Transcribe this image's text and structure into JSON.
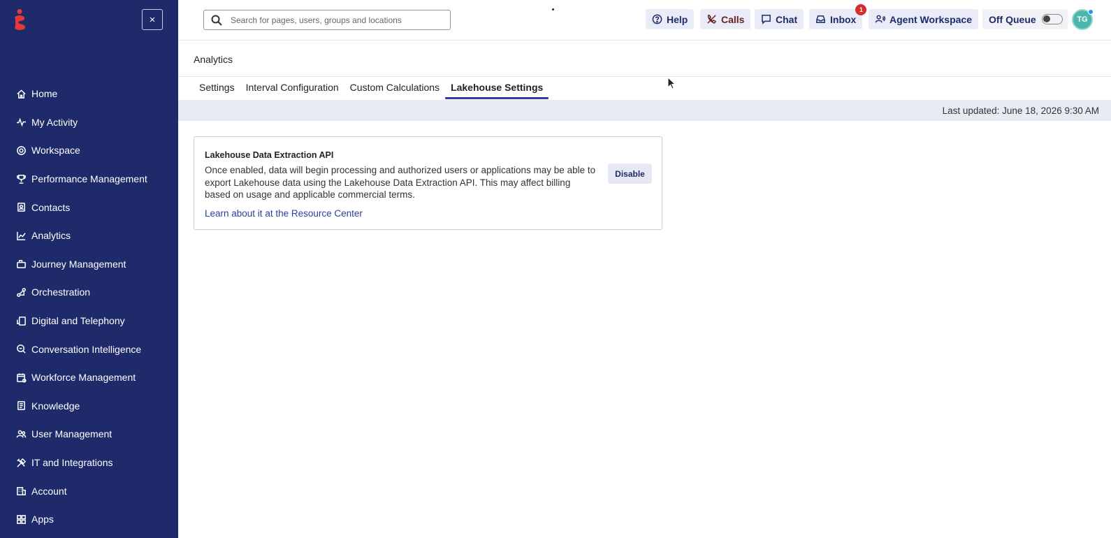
{
  "sidebar": {
    "close_label": "×",
    "items": [
      {
        "label": "Home",
        "icon": "home-icon"
      },
      {
        "label": "My Activity",
        "icon": "activity-icon"
      },
      {
        "label": "Workspace",
        "icon": "workspace-icon"
      },
      {
        "label": "Performance Management",
        "icon": "trophy-icon"
      },
      {
        "label": "Contacts",
        "icon": "contacts-icon"
      },
      {
        "label": "Analytics",
        "icon": "analytics-icon"
      },
      {
        "label": "Journey Management",
        "icon": "journey-icon"
      },
      {
        "label": "Orchestration",
        "icon": "orchestration-icon"
      },
      {
        "label": "Digital and Telephony",
        "icon": "telephony-icon"
      },
      {
        "label": "Conversation Intelligence",
        "icon": "conversation-intelligence-icon"
      },
      {
        "label": "Workforce Management",
        "icon": "calendar-icon"
      },
      {
        "label": "Knowledge",
        "icon": "book-icon"
      },
      {
        "label": "User Management",
        "icon": "users-icon"
      },
      {
        "label": "IT and Integrations",
        "icon": "tools-icon"
      },
      {
        "label": "Account",
        "icon": "building-icon"
      },
      {
        "label": "Apps",
        "icon": "apps-icon"
      }
    ]
  },
  "topbar": {
    "search_placeholder": "Search for pages, users, groups and locations",
    "help": "Help",
    "calls": "Calls",
    "chat": "Chat",
    "inbox": "Inbox",
    "inbox_badge": "1",
    "agent_workspace": "Agent Workspace",
    "queue_status": "Off Queue",
    "avatar_initials": "TG"
  },
  "page": {
    "title": "Analytics",
    "tabs": [
      "Settings",
      "Interval Configuration",
      "Custom Calculations",
      "Lakehouse Settings"
    ],
    "active_tab": "Lakehouse Settings",
    "last_updated": "Last updated: June 18, 2026 9:30 AM"
  },
  "card": {
    "title": "Lakehouse Data Extraction API",
    "body": "Once enabled, data will begin processing and authorized users or applications may be able to export Lakehouse data using the Lakehouse Data Extraction API. This may affect billing based on usage and applicable commercial terms.",
    "link": "Learn about it at the Resource Center",
    "button": "Disable"
  },
  "colors": {
    "sidebar_bg": "#1f2a6b",
    "accent": "#2b3f9d",
    "brand_logo": "#e53935",
    "badge": "#d32f2f"
  }
}
